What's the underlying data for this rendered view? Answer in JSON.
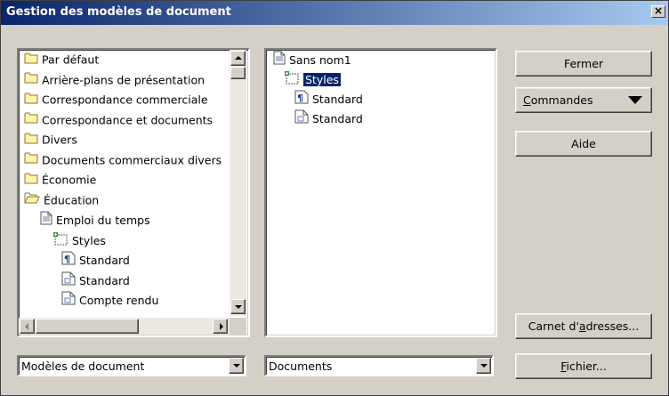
{
  "window": {
    "title": "Gestion des modèles de document",
    "close_glyph": "×"
  },
  "left_tree": {
    "items": [
      {
        "label": "Par défaut",
        "icon": "folder-icon"
      },
      {
        "label": "Arrière-plans de présentation",
        "icon": "folder-icon"
      },
      {
        "label": "Correspondance commerciale",
        "icon": "folder-icon"
      },
      {
        "label": "Correspondance et documents",
        "icon": "folder-icon"
      },
      {
        "label": "Divers",
        "icon": "folder-icon"
      },
      {
        "label": "Documents commerciaux divers",
        "icon": "folder-icon"
      },
      {
        "label": "Économie",
        "icon": "folder-icon"
      },
      {
        "label": "Éducation",
        "icon": "folder-open-icon"
      },
      {
        "label": "Emploi du temps",
        "icon": "document-icon"
      },
      {
        "label": "Styles",
        "icon": "styles-icon"
      },
      {
        "label": "Standard",
        "icon": "paragraph-style-icon"
      },
      {
        "label": "Standard",
        "icon": "page-style-icon"
      },
      {
        "label": "Compte rendu",
        "icon": "page-style-icon"
      }
    ]
  },
  "right_tree": {
    "items": [
      {
        "label": "Sans nom1",
        "icon": "document-icon"
      },
      {
        "label": "Styles",
        "icon": "styles-icon",
        "selected": true
      },
      {
        "label": "Standard",
        "icon": "paragraph-style-icon"
      },
      {
        "label": "Standard",
        "icon": "page-style-icon"
      }
    ]
  },
  "left_combo": {
    "value": "Modèles de document"
  },
  "right_combo": {
    "value": "Documents"
  },
  "buttons": {
    "fermer": "Fermer",
    "commandes_hot": "C",
    "commandes_rest": "ommandes",
    "aide": "Aide",
    "carnet_pre": "Carnet d'",
    "carnet_hot": "a",
    "carnet_post": "dresses...",
    "fichier_hot": "F",
    "fichier_rest": "ichier..."
  },
  "colors": {
    "dialog_bg": "#d4d0c8",
    "title_gradient_start": "#0a246a",
    "title_gradient_end": "#a6caf0",
    "selection": "#0a246a",
    "folder": "#fff3b0"
  }
}
